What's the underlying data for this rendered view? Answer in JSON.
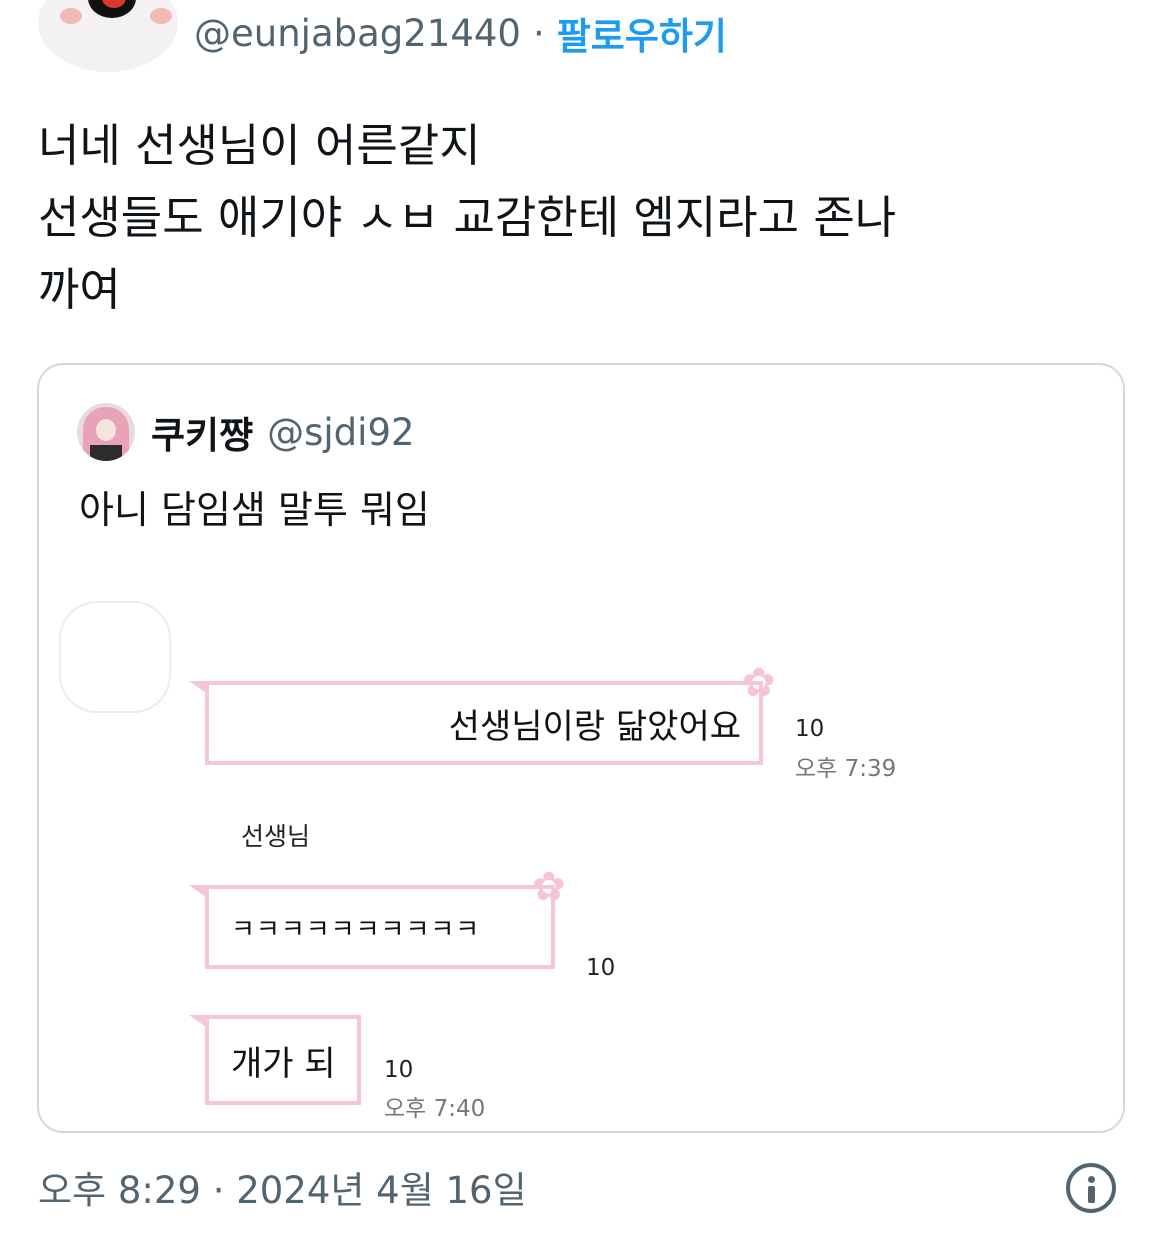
{
  "author": {
    "handle": "@eunjabag21440",
    "separator": "·",
    "follow_label": "팔로우하기"
  },
  "tweet": {
    "text": "너네 선생님이 어른같지\n선생들도 애기야 ㅅㅂ 교감한테 엠지라고 존나\n까여"
  },
  "quote": {
    "name": "쿠키쨩",
    "handle": "@sjdi92",
    "text": "아니 담임샘 말투 뭐임",
    "chat": {
      "messages": [
        {
          "text": "선생님이랑 닮았어요",
          "count": "10",
          "time": "오후 7:39"
        },
        {
          "sender": "선생님",
          "text": "ㅋㅋㅋㅋㅋㅋㅋㅋㅋㅋ",
          "count": "10"
        },
        {
          "text": "개가 되",
          "count": "10",
          "time": "오후 7:40"
        }
      ]
    }
  },
  "footer": {
    "timestamp": "오후 8:29 · 2024년 4월 16일"
  },
  "colors": {
    "link": "#1d9bf0",
    "muted": "#536471",
    "bubble_border": "#f4c6d7"
  },
  "icons": [
    "penguin-avatar",
    "pink-hair-avatar",
    "flower-icon",
    "info-icon"
  ]
}
